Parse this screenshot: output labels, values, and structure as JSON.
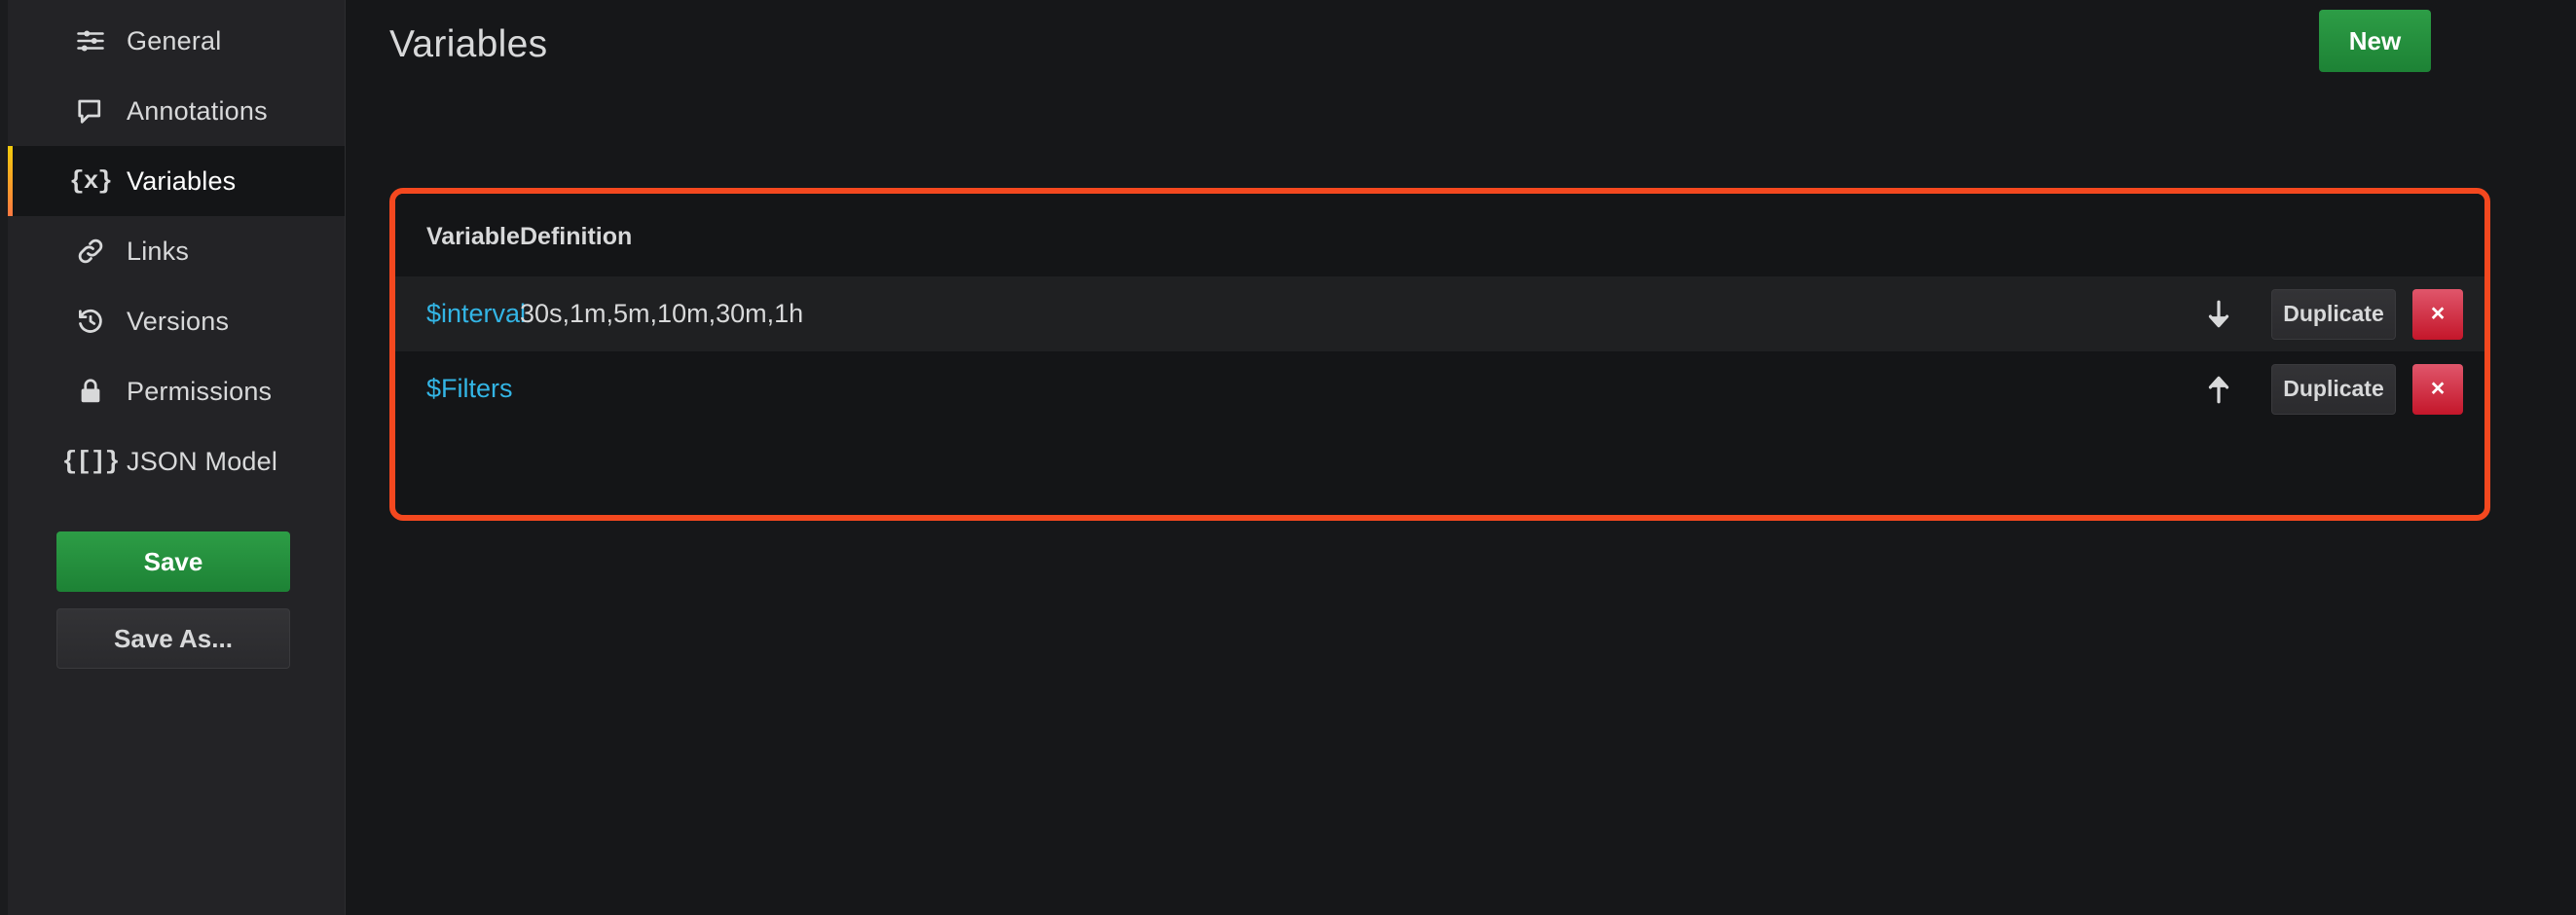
{
  "sidebar": {
    "items": [
      {
        "label": "General",
        "icon": "sliders-icon",
        "active": false
      },
      {
        "label": "Annotations",
        "icon": "comment-icon",
        "active": false
      },
      {
        "label": "Variables",
        "icon": "braces-x-icon",
        "active": true
      },
      {
        "label": "Links",
        "icon": "link-icon",
        "active": false
      },
      {
        "label": "Versions",
        "icon": "history-icon",
        "active": false
      },
      {
        "label": "Permissions",
        "icon": "lock-icon",
        "active": false
      },
      {
        "label": "JSON Model",
        "icon": "braces-brackets-icon",
        "active": false
      }
    ],
    "save_label": "Save",
    "save_as_label": "Save As...",
    "json_model_icon_glyph": "{[]}",
    "variables_icon_glyph": "{x}"
  },
  "header": {
    "title": "Variables",
    "new_label": "New"
  },
  "table": {
    "columns": [
      "Variable",
      "Definition"
    ],
    "rows": [
      {
        "variable": "$interval",
        "definition": "30s,1m,5m,10m,30m,1h",
        "move_icon": "arrow-down-icon",
        "duplicate_label": "Duplicate",
        "delete_label": "×",
        "hovered": true
      },
      {
        "variable": "$Filters",
        "definition": "",
        "move_icon": "arrow-up-icon",
        "duplicate_label": "Duplicate",
        "delete_label": "×",
        "hovered": false
      }
    ]
  },
  "colors": {
    "accent_green": "#2d9d46",
    "variable_link": "#33b5e5",
    "highlight_border": "#f4481f",
    "delete_red": "#c4162a",
    "active_bar_top": "#f2cc0c",
    "active_bar_bottom": "#ff7941",
    "sidebar_bg": "#232326",
    "main_bg": "#161719",
    "panel_bg": "#141517",
    "row_hover_bg": "#1f2022"
  }
}
